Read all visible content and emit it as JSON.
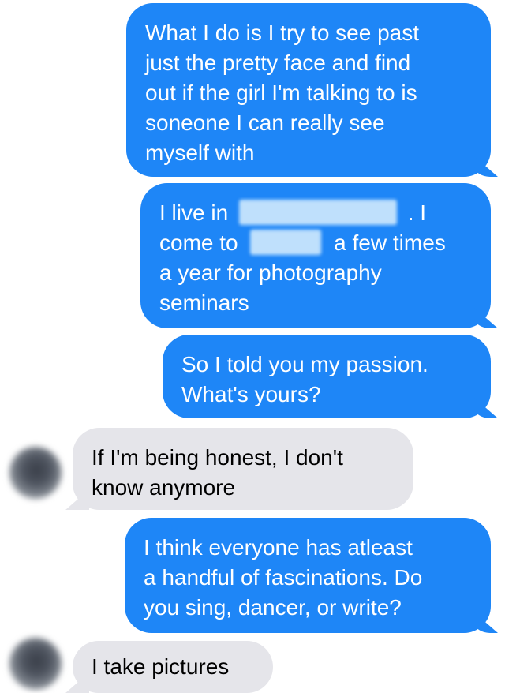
{
  "conversation": {
    "messages": [
      {
        "direction": "sent",
        "lines": [
          "What I do is I try to see past",
          "just the pretty face and find",
          "out if the girl I'm talking to is",
          "soneone I can really see",
          "myself with"
        ]
      },
      {
        "direction": "sent",
        "line1_start": "I live in",
        "line1_end": ". I",
        "line2_start": "come to",
        "line2_end": "a few times",
        "line3": "a year for photography",
        "line4": "seminars"
      },
      {
        "direction": "sent",
        "lines": [
          "So I told you my passion.",
          "What's yours?"
        ]
      },
      {
        "direction": "received",
        "lines": [
          "If I'm being honest, I don't",
          "know anymore"
        ]
      },
      {
        "direction": "sent",
        "lines": [
          "I think everyone has atleast",
          "a handful of fascinations. Do",
          "you sing, dancer, or write?"
        ]
      },
      {
        "direction": "received",
        "lines": [
          "I take pictures"
        ]
      }
    ]
  },
  "colors": {
    "sent_bubble": "#1E86F7",
    "received_bubble": "#E5E5EA",
    "background": "#FFFFFF"
  },
  "icons": {
    "avatar": "contact-avatar-blurred",
    "redaction": "redacted-blur"
  }
}
